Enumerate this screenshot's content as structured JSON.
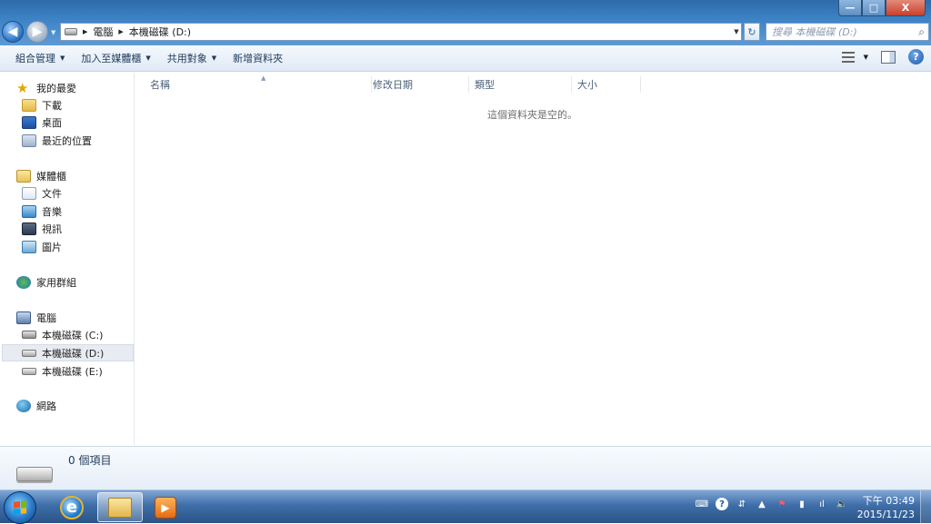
{
  "window": {
    "min_glyph": "—",
    "max_glyph": "□",
    "close_glyph": "X"
  },
  "address": {
    "crumbs": [
      "電腦",
      "本機磁碟 (D:)"
    ]
  },
  "search": {
    "placeholder": "搜尋 本機磁碟 (D:)"
  },
  "toolbar": {
    "organize": "組合管理",
    "add_to_library": "加入至媒體櫃",
    "share_with": "共用對象",
    "new_folder": "新增資料夾"
  },
  "nav": {
    "favorites": "我的最愛",
    "downloads": "下載",
    "desktop": "桌面",
    "recent": "最近的位置",
    "libraries": "媒體櫃",
    "documents": "文件",
    "music": "音樂",
    "videos": "視訊",
    "pictures": "圖片",
    "homegroup": "家用群組",
    "computer": "電腦",
    "drive_c": "本機磁碟 (C:)",
    "drive_d": "本機磁碟 (D:)",
    "drive_e": "本機磁碟 (E:)",
    "network": "網路"
  },
  "columns": {
    "name": "名稱",
    "date_modified": "修改日期",
    "type": "類型",
    "size": "大小"
  },
  "content": {
    "empty_message": "這個資料夾是空的。"
  },
  "details": {
    "item_count": "0 個項目"
  },
  "taskbar": {
    "clock_time": "下午 03:49",
    "clock_date": "2015/11/23"
  },
  "colors": {
    "titlebar": "#3b82c4",
    "selection": "#e8ecf2",
    "taskbar": "#3f6ea8"
  }
}
